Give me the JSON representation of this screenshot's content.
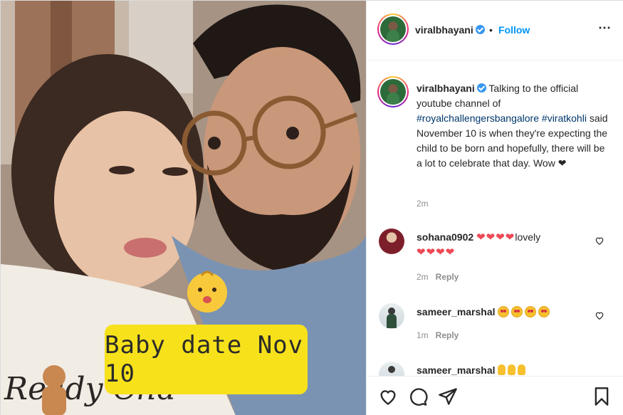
{
  "post": {
    "photo": {
      "overlay_text": "Baby date Nov 10",
      "baby_sticker": "baby-face-emoji"
    },
    "header": {
      "username": "viralbhayani",
      "verified": true,
      "separator": "•",
      "follow_label": "Follow",
      "more_icon": "⋯"
    },
    "caption": {
      "username": "viralbhayani",
      "text_before": " Talking to the official youtube channel of ",
      "hashtag_1": "#royalchallengersbangalore",
      "hashtag_2": "#viratkohli",
      "text_after": " said November 10 is when they're expecting the child to be born and hopefully, there will be a lot to celebrate that day. Wow ❤",
      "time": "2m"
    },
    "comments": [
      {
        "username": "sohana0902",
        "text": "lovely",
        "emoji_before": "❤❤❤❤",
        "emoji_after": "❤❤❤❤",
        "time": "2m",
        "reply_label": "Reply"
      },
      {
        "username": "sameer_marshal",
        "emoji": "star-struck-face x4",
        "time": "1m",
        "reply_label": "Reply"
      },
      {
        "username": "sameer_marshal",
        "emoji": "clapping-hands x3"
      }
    ],
    "action_icons": [
      "heart-icon",
      "comment-icon",
      "share-icon",
      "bookmark-icon"
    ],
    "colors": {
      "link_blue": "#0095f6",
      "hashtag": "#00376b",
      "meta_grey": "#8e8e8e",
      "heart_red": "#ed4956",
      "sticker_yellow": "#f7e11b"
    }
  }
}
